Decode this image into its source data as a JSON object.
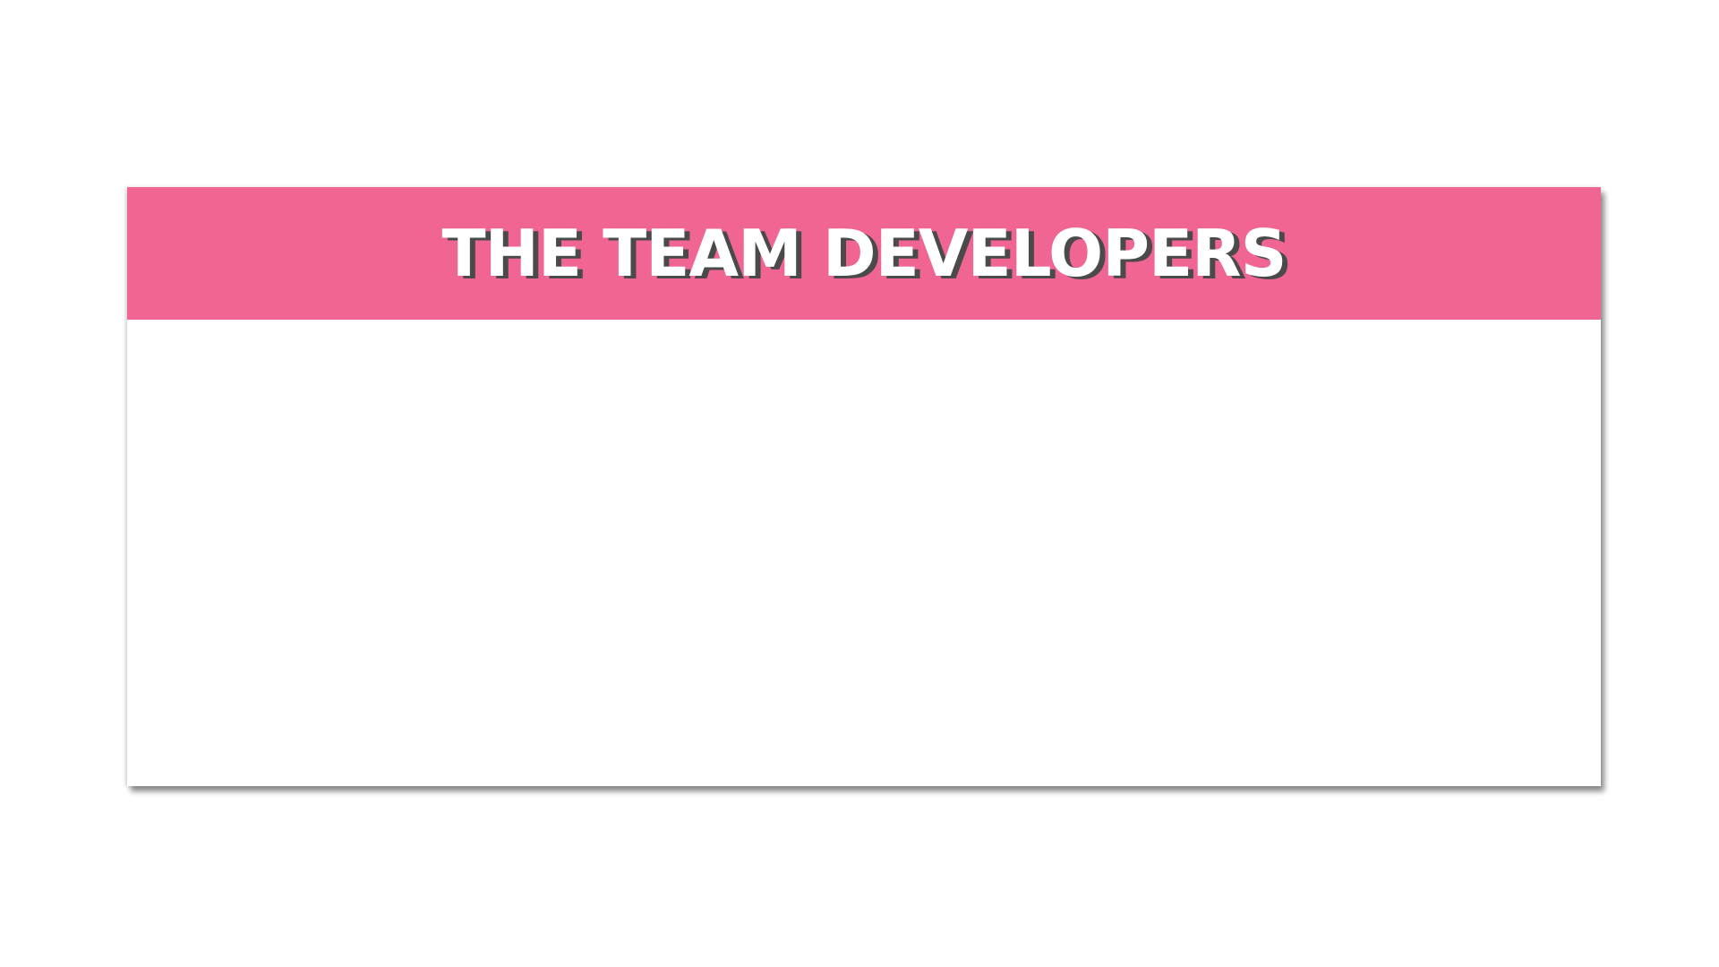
{
  "banner": {
    "title": "THE TEAM DEVELOPERS"
  },
  "colors": {
    "banner_background": "#f06592",
    "title_text": "#ffffff",
    "title_shadow": "#4a4a4a",
    "card_background": "#ffffff"
  }
}
